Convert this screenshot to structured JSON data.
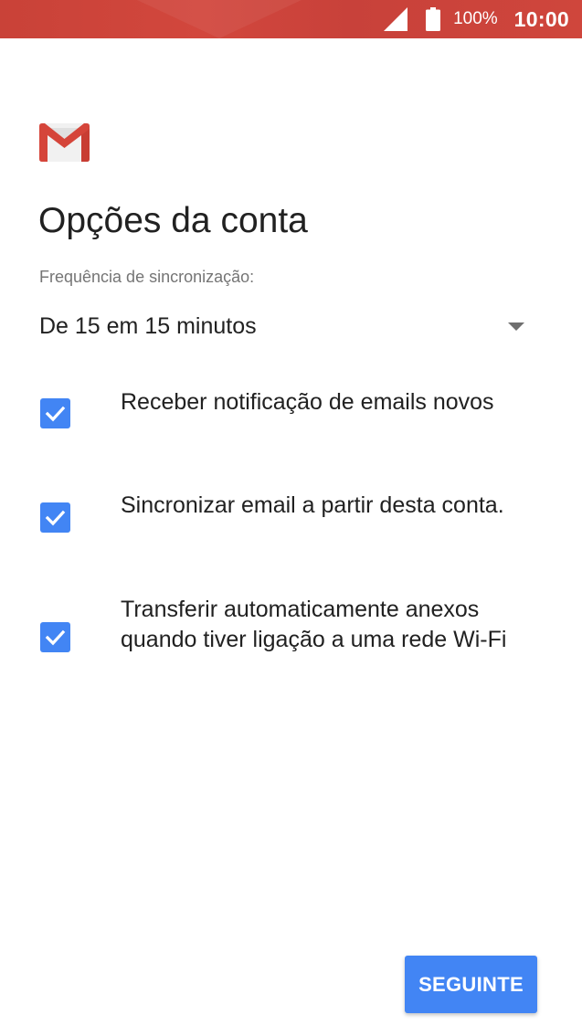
{
  "status_bar": {
    "battery_percent": "100%",
    "time": "10:00",
    "signal_icon": "cellular-signal-icon",
    "battery_icon": "battery-full-icon",
    "background_color": "#c94238"
  },
  "app": {
    "logo_icon": "gmail-logo-icon"
  },
  "page": {
    "title": "Opções da conta"
  },
  "sync": {
    "label": "Frequência de sincronização:",
    "selected_value": "De 15 em 15 minutos"
  },
  "options": [
    {
      "label": "Receber notificação de emails novos",
      "checked": true
    },
    {
      "label": "Sincronizar email a partir desta conta.",
      "checked": true
    },
    {
      "label": "Transferir automaticamente anexos quando tiver ligação a uma rede Wi-Fi",
      "checked": true
    }
  ],
  "actions": {
    "next_label": "SEGUINTE"
  },
  "colors": {
    "accent": "#4285f4",
    "text_primary": "#212121",
    "text_secondary": "#757575"
  }
}
